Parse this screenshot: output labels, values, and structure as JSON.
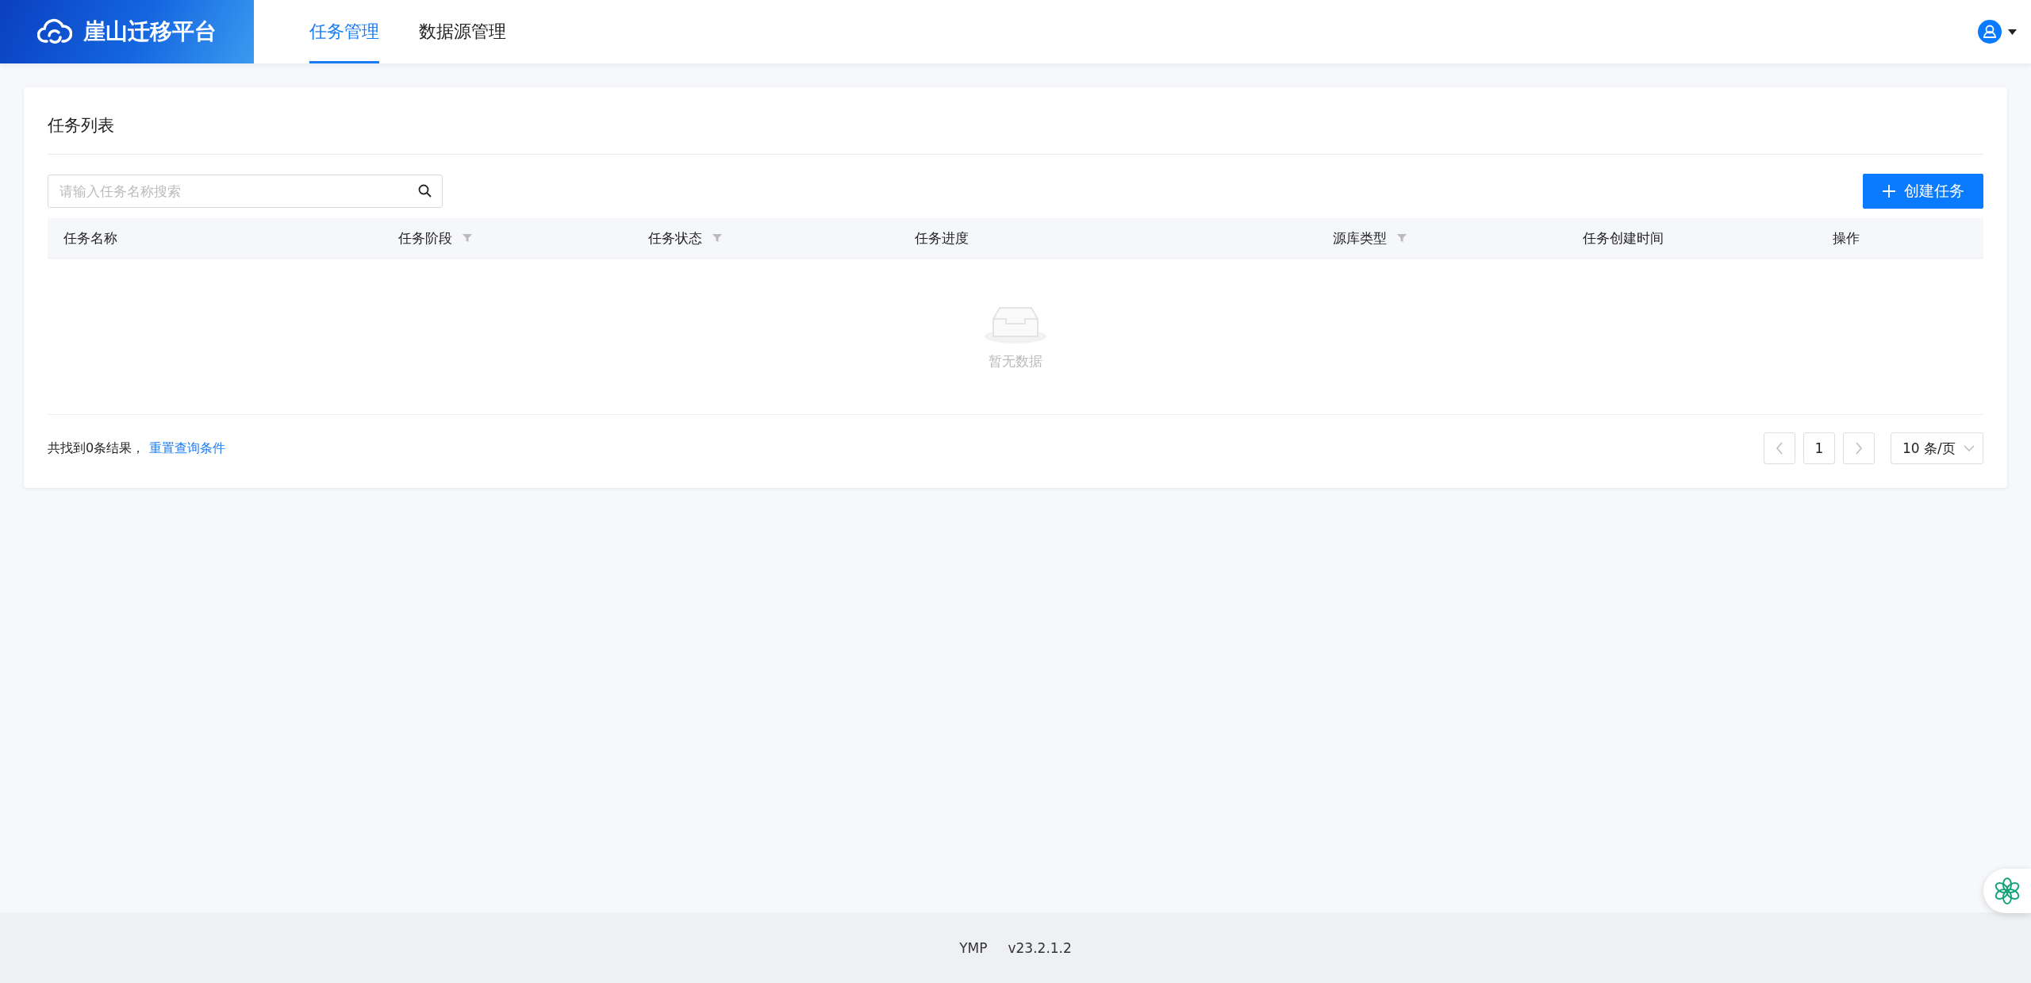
{
  "header": {
    "logo_text": "崖山迁移平台",
    "tabs": [
      {
        "label": "任务管理",
        "selected": true
      },
      {
        "label": "数据源管理",
        "selected": false
      }
    ]
  },
  "task_list": {
    "title": "任务列表",
    "search": {
      "placeholder": "请输入任务名称搜索"
    },
    "create_button": "创建任务",
    "columns": [
      {
        "label": "任务名称",
        "filter": false
      },
      {
        "label": "任务阶段",
        "filter": true
      },
      {
        "label": "任务状态",
        "filter": true
      },
      {
        "label": "任务进度",
        "filter": false
      },
      {
        "label": "源库类型",
        "filter": true
      },
      {
        "label": "任务创建时间",
        "filter": false
      },
      {
        "label": "操作",
        "filter": false
      }
    ],
    "empty_text": "暂无数据",
    "summary": "共找到0条结果，",
    "reset_link": "重置查询条件",
    "pagination": {
      "prev_disabled": true,
      "next_disabled": true,
      "pages": [
        {
          "label": "1",
          "selected": true
        }
      ],
      "page_size": "10 条/页"
    }
  },
  "footer": {
    "product": "YMP",
    "version": "v23.2.1.2"
  }
}
